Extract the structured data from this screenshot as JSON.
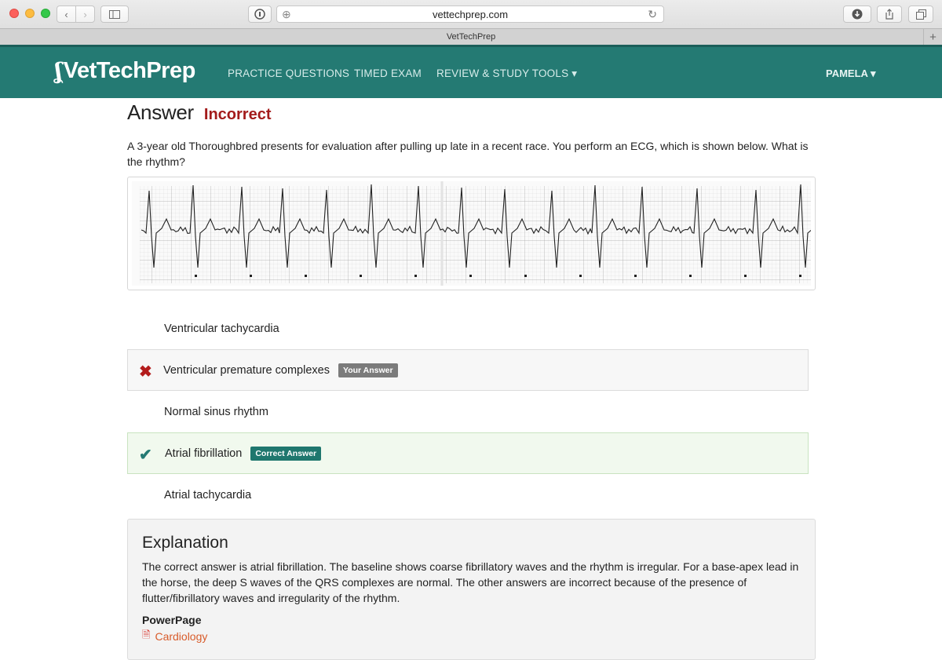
{
  "browser": {
    "url": "vettechprep.com",
    "tab_title": "VetTechPrep",
    "back_icon": "chevron-left-icon",
    "forward_icon": "chevron-right-icon"
  },
  "nav": {
    "logo": "VetTechPrep",
    "links": [
      "PRACTICE QUESTIONS",
      "TIMED EXAM",
      "REVIEW & STUDY TOOLS ▾"
    ],
    "user": "PAMELA ▾"
  },
  "answer": {
    "heading": "Answer",
    "status": "Incorrect",
    "question": "A 3-year old Thoroughbred presents for evaluation after pulling up late in a recent race. You perform an ECG, which is shown below. What is the rhythm?"
  },
  "choices": [
    {
      "label": "Ventricular tachycardia"
    },
    {
      "label": "Ventricular premature complexes",
      "badge": "Your Answer"
    },
    {
      "label": "Normal sinus rhythm"
    },
    {
      "label": "Atrial fibrillation",
      "badge": "Correct Answer"
    },
    {
      "label": "Atrial tachycardia"
    }
  ],
  "explanation": {
    "title": "Explanation",
    "text": "The correct answer is atrial fibrillation. The baseline shows coarse fibrillatory waves and the rhythm is irregular. For a base-apex lead in the horse, the deep S waves of the QRS complexes are normal. The other answers are incorrect because of the presence of flutter/fibrillatory waves and irregularity of the rhythm.",
    "powerpage_label": "PowerPage",
    "powerpage_link": "Cardiology"
  },
  "colors": {
    "nav_bg": "#247a73",
    "incorrect": "#a31b1b",
    "correct_bg": "#f1f9ee",
    "badge_correct": "#1f776e",
    "badge_yours": "#7b7b7b",
    "link": "#d85b2a"
  }
}
